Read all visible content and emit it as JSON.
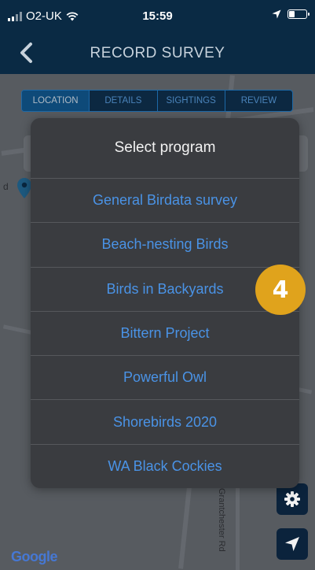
{
  "status_bar": {
    "carrier": "O2-UK",
    "time": "15:59"
  },
  "nav": {
    "title": "RECORD SURVEY"
  },
  "tabs": [
    {
      "label": "LOCATION",
      "active": true
    },
    {
      "label": "DETAILS",
      "active": false
    },
    {
      "label": "SIGHTINGS",
      "active": false
    },
    {
      "label": "REVIEW",
      "active": false
    }
  ],
  "map": {
    "street_label": "Grantchester Rd",
    "pin_label": "d",
    "attribution": "Google"
  },
  "dialog": {
    "title": "Select program",
    "options": [
      "General Birdata survey",
      "Beach-nesting Birds",
      "Birds in Backyards",
      "Bittern Project",
      "Powerful Owl",
      "Shorebirds 2020",
      "WA Black Cockies"
    ]
  },
  "badge": {
    "number": "4"
  },
  "colors": {
    "nav": "#0a2a44",
    "option_text": "#4a93e6",
    "dialog_bg": "#3a3c40",
    "badge": "#e0a31c",
    "tab_active": "#0f4e80"
  },
  "icons": [
    "signal-icon",
    "wifi-icon",
    "location-arrow-icon",
    "battery-icon",
    "back-chevron-icon",
    "map-pin-icon",
    "gear-icon",
    "navigate-icon"
  ]
}
